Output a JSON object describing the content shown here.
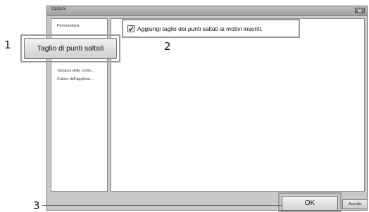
{
  "dialog": {
    "title": "Opzioni"
  },
  "sidebar": {
    "items": [
      {
        "label": "Personalizza"
      },
      {
        "label": "Taratura dello scher..."
      },
      {
        "label": "Colore dell'applicaz..."
      }
    ]
  },
  "main_button": {
    "label": "Taglio di punti saltati"
  },
  "checkbox": {
    "label": "Aggiungi taglio dei punti saltati ai motivi inseriti.",
    "checked": true
  },
  "footer": {
    "ok_label": "OK",
    "cancel_label": "Annulla"
  },
  "callouts": [
    "1",
    "2",
    "3"
  ],
  "icons": {
    "close": "close-icon",
    "check": "check-icon"
  }
}
